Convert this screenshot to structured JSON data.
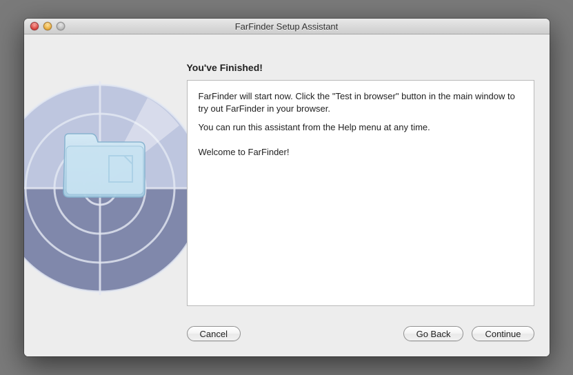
{
  "window": {
    "title": "FarFinder Setup Assistant"
  },
  "page": {
    "heading": "You've Finished!",
    "paragraph1": "FarFinder will start now. Click the \"Test in browser\" button in the main window to try out FarFinder in your browser.",
    "paragraph2": "You can run this assistant from the Help menu at any time.",
    "paragraph3": "Welcome to FarFinder!"
  },
  "buttons": {
    "cancel": "Cancel",
    "goBack": "Go Back",
    "continue": "Continue"
  }
}
